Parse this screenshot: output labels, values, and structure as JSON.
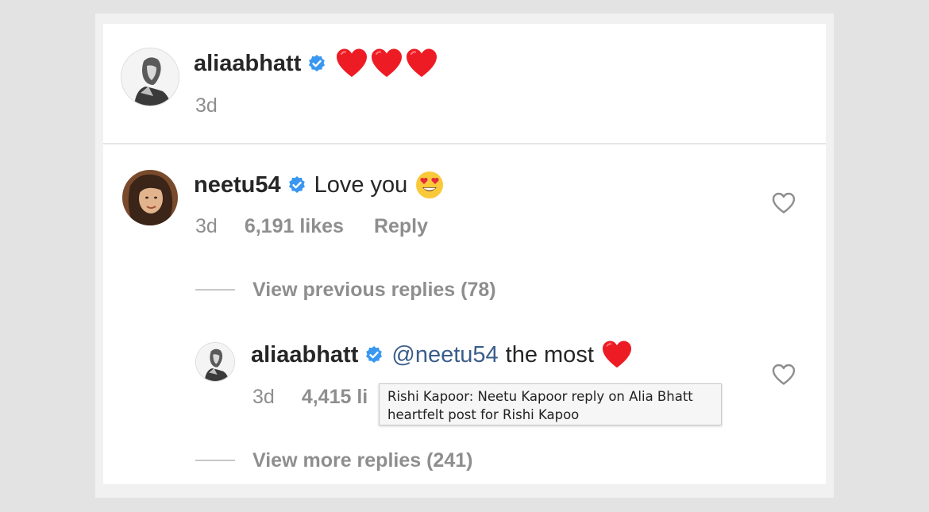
{
  "post": {
    "username": "aliaabhatt",
    "timestamp": "3d"
  },
  "comment": {
    "username": "neetu54",
    "text": "Love you",
    "timestamp": "3d",
    "likes": "6,191 likes",
    "reply_label": "Reply",
    "view_previous": "View previous replies (78)"
  },
  "reply": {
    "username": "aliaabhatt",
    "mention": "@neetu54",
    "text": "the most",
    "timestamp": "3d",
    "likes": "4,415 li",
    "view_more": "View more replies (241)"
  },
  "tooltip": {
    "text": "Rishi Kapoor: Neetu Kapoor reply on Alia Bhatt heartfelt post for Rishi Kapoo"
  },
  "colors": {
    "verified": "#3897f0",
    "heart": "#ed1c24",
    "muted": "#8e8e8e",
    "mention": "#3b5d8a"
  },
  "icons": {
    "verified": "verified-badge-icon",
    "heart": "red-heart-emoji-icon",
    "heart_eyes": "heart-eyes-emoji-icon",
    "like": "heart-outline-icon"
  }
}
